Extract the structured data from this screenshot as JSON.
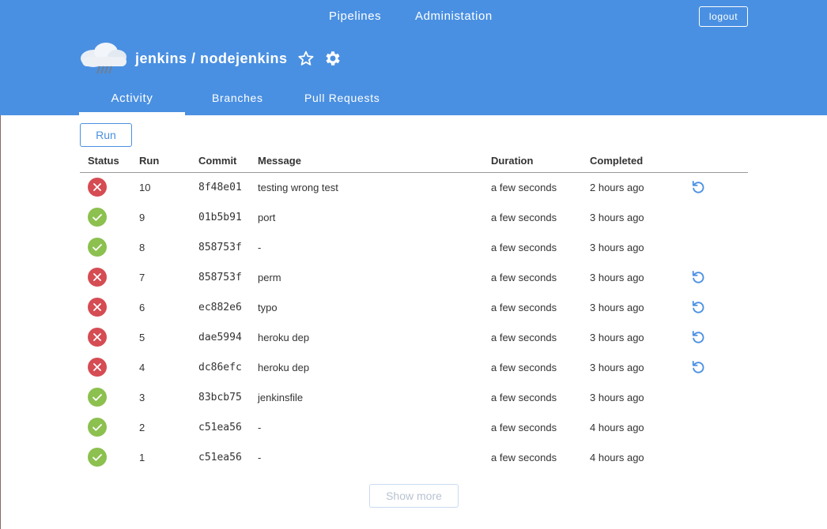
{
  "nav": {
    "pipelines": "Pipelines",
    "administration": "Administation",
    "logout": "logout"
  },
  "repo": {
    "title": "jenkins / nodejenkins",
    "weather_icon": "cloud-rain-icon",
    "star_icon": "star-outline-icon",
    "settings_icon": "gear-icon"
  },
  "tabs": [
    {
      "label": "Activity",
      "active": true
    },
    {
      "label": "Branches",
      "active": false
    },
    {
      "label": "Pull Requests",
      "active": false
    }
  ],
  "run_button": "Run",
  "table": {
    "headers": [
      "Status",
      "Run",
      "Commit",
      "Message",
      "Duration",
      "Completed",
      ""
    ],
    "rows": [
      {
        "status": "failed",
        "run": "10",
        "commit": "8f48e01",
        "message": "testing wrong test",
        "duration": "a few seconds",
        "completed": "2 hours ago",
        "replay": true
      },
      {
        "status": "success",
        "run": "9",
        "commit": "01b5b91",
        "message": "port",
        "duration": "a few seconds",
        "completed": "3 hours ago",
        "replay": false
      },
      {
        "status": "success",
        "run": "8",
        "commit": "858753f",
        "message": "-",
        "duration": "a few seconds",
        "completed": "3 hours ago",
        "replay": false
      },
      {
        "status": "failed",
        "run": "7",
        "commit": "858753f",
        "message": "perm",
        "duration": "a few seconds",
        "completed": "3 hours ago",
        "replay": true
      },
      {
        "status": "failed",
        "run": "6",
        "commit": "ec882e6",
        "message": "typo",
        "duration": "a few seconds",
        "completed": "3 hours ago",
        "replay": true
      },
      {
        "status": "failed",
        "run": "5",
        "commit": "dae5994",
        "message": "heroku dep",
        "duration": "a few seconds",
        "completed": "3 hours ago",
        "replay": true
      },
      {
        "status": "failed",
        "run": "4",
        "commit": "dc86efc",
        "message": "heroku dep",
        "duration": "a few seconds",
        "completed": "3 hours ago",
        "replay": true
      },
      {
        "status": "success",
        "run": "3",
        "commit": "83bcb75",
        "message": "jenkinsfile",
        "duration": "a few seconds",
        "completed": "3 hours ago",
        "replay": false
      },
      {
        "status": "success",
        "run": "2",
        "commit": "c51ea56",
        "message": "-",
        "duration": "a few seconds",
        "completed": "4 hours ago",
        "replay": false
      },
      {
        "status": "success",
        "run": "1",
        "commit": "c51ea56",
        "message": "-",
        "duration": "a few seconds",
        "completed": "4 hours ago",
        "replay": false
      }
    ]
  },
  "show_more": "Show more",
  "colors": {
    "header_bg": "#4a90e2",
    "failed": "#d54c53",
    "success": "#8cc04f",
    "accent": "#4a90e2"
  }
}
